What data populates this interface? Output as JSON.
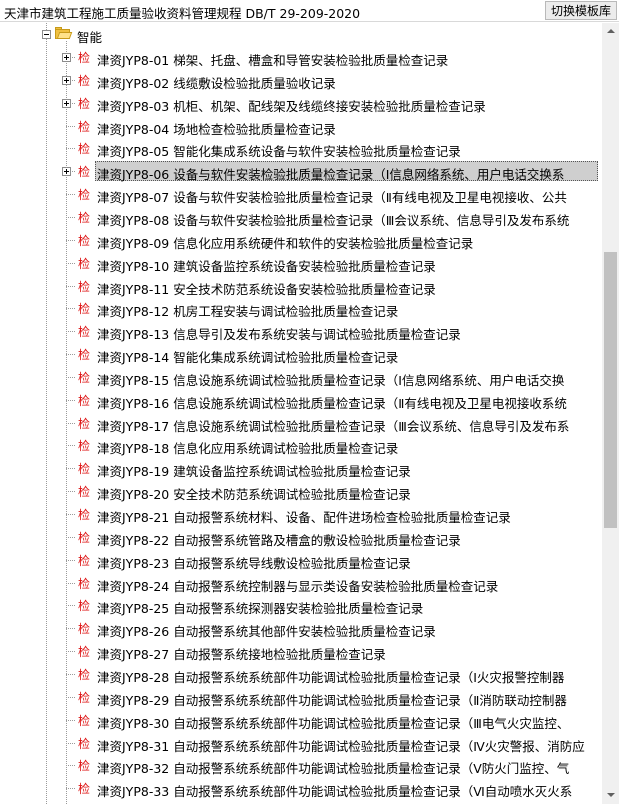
{
  "header": {
    "title": "天津市建筑工程施工质量验收资料管理规程 DB/T 29-209-2020",
    "switch_button": "切换模板库"
  },
  "tree": {
    "category": {
      "label": "智能",
      "expanded": true,
      "icon": "folder-open-icon"
    },
    "item_marker": "检",
    "selected_index": 5,
    "items": [
      {
        "label": "津资JYP8-01 梯架、托盘、槽盒和导管安装检验批质量检查记录",
        "expandable": true
      },
      {
        "label": "津资JYP8-02 线缆敷设检验批质量验收记录",
        "expandable": true
      },
      {
        "label": "津资JYP8-03 机柜、机架、配线架及线缆终接安装检验批质量检查记录",
        "expandable": true
      },
      {
        "label": "津资JYP8-04 场地检查检验批质量检查记录",
        "expandable": false
      },
      {
        "label": "津资JYP8-05 智能化集成系统设备与软件安装检验批质量检查记录",
        "expandable": false
      },
      {
        "label": "津资JYP8-06 设备与软件安装检验批质量检查记录（Ⅰ信息网络系统、用户电话交换系",
        "expandable": true
      },
      {
        "label": "津资JYP8-07 设备与软件安装检验批质量检查记录（Ⅱ有线电视及卫星电视接收、公共",
        "expandable": false
      },
      {
        "label": "津资JYP8-08 设备与软件安装检验批质量检查记录（Ⅲ会议系统、信息导引及发布系统",
        "expandable": false
      },
      {
        "label": "津资JYP8-09 信息化应用系统硬件和软件的安装检验批质量检查记录",
        "expandable": false
      },
      {
        "label": "津资JYP8-10 建筑设备监控系统设备安装检验批质量检查记录",
        "expandable": false
      },
      {
        "label": "津资JYP8-11 安全技术防范系统设备安装检验批质量检查记录",
        "expandable": false
      },
      {
        "label": "津资JYP8-12 机房工程安装与调试检验批质量检查记录",
        "expandable": false
      },
      {
        "label": "津资JYP8-13 信息导引及发布系统安装与调试检验批质量检查记录",
        "expandable": false
      },
      {
        "label": "津资JYP8-14 智能化集成系统调试检验批质量检查记录",
        "expandable": false
      },
      {
        "label": "津资JYP8-15 信息设施系统调试检验批质量检查记录（Ⅰ信息网络系统、用户电话交换",
        "expandable": false
      },
      {
        "label": "津资JYP8-16 信息设施系统调试检验批质量检查记录（Ⅱ有线电视及卫星电视接收系统",
        "expandable": false
      },
      {
        "label": "津资JYP8-17 信息设施系统调试检验批质量检查记录（Ⅲ会议系统、信息导引及发布系",
        "expandable": false
      },
      {
        "label": "津资JYP8-18 信息化应用系统调试检验批质量检查记录",
        "expandable": false
      },
      {
        "label": "津资JYP8-19 建筑设备监控系统调试检验批质量检查记录",
        "expandable": false
      },
      {
        "label": "津资JYP8-20 安全技术防范系统调试检验批质量检查记录",
        "expandable": false
      },
      {
        "label": "津资JYP8-21 自动报警系统材料、设备、配件进场检查检验批质量检查记录",
        "expandable": false
      },
      {
        "label": "津资JYP8-22 自动报警系统管路及槽盒的敷设检验批质量检查记录",
        "expandable": false
      },
      {
        "label": "津资JYP8-23 自动报警系统导线敷设检验批质量检查记录",
        "expandable": false
      },
      {
        "label": "津资JYP8-24 自动报警系统控制器与显示类设备安装检验批质量检查记录",
        "expandable": false
      },
      {
        "label": "津资JYP8-25 自动报警系统探测器安装检验批质量检查记录",
        "expandable": false
      },
      {
        "label": "津资JYP8-26 自动报警系统其他部件安装检验批质量检查记录",
        "expandable": false
      },
      {
        "label": "津资JYP8-27 自动报警系统接地检验批质量检查记录",
        "expandable": false
      },
      {
        "label": "津资JYP8-28 自动报警系统系统部件功能调试检验批质量检查记录（Ⅰ火灾报警控制器",
        "expandable": false
      },
      {
        "label": "津资JYP8-29 自动报警系统系统部件功能调试检验批质量检查记录（Ⅱ消防联动控制器",
        "expandable": false
      },
      {
        "label": "津资JYP8-30 自动报警系统系统部件功能调试检验批质量检查记录（Ⅲ电气火灾监控、",
        "expandable": false
      },
      {
        "label": "津资JYP8-31 自动报警系统系统部件功能调试检验批质量检查记录（Ⅳ火灾警报、消防应",
        "expandable": false
      },
      {
        "label": "津资JYP8-32 自动报警系统系统部件功能调试检验批质量检查记录（Ⅴ防火门监控、气",
        "expandable": false
      },
      {
        "label": "津资JYP8-33 自动报警系统系统部件功能调试检验批质量检查记录（Ⅵ自动喷水灭火系",
        "expandable": false
      }
    ]
  },
  "scrollbar": {
    "position": 0.45,
    "visible_fraction": 0.37
  }
}
